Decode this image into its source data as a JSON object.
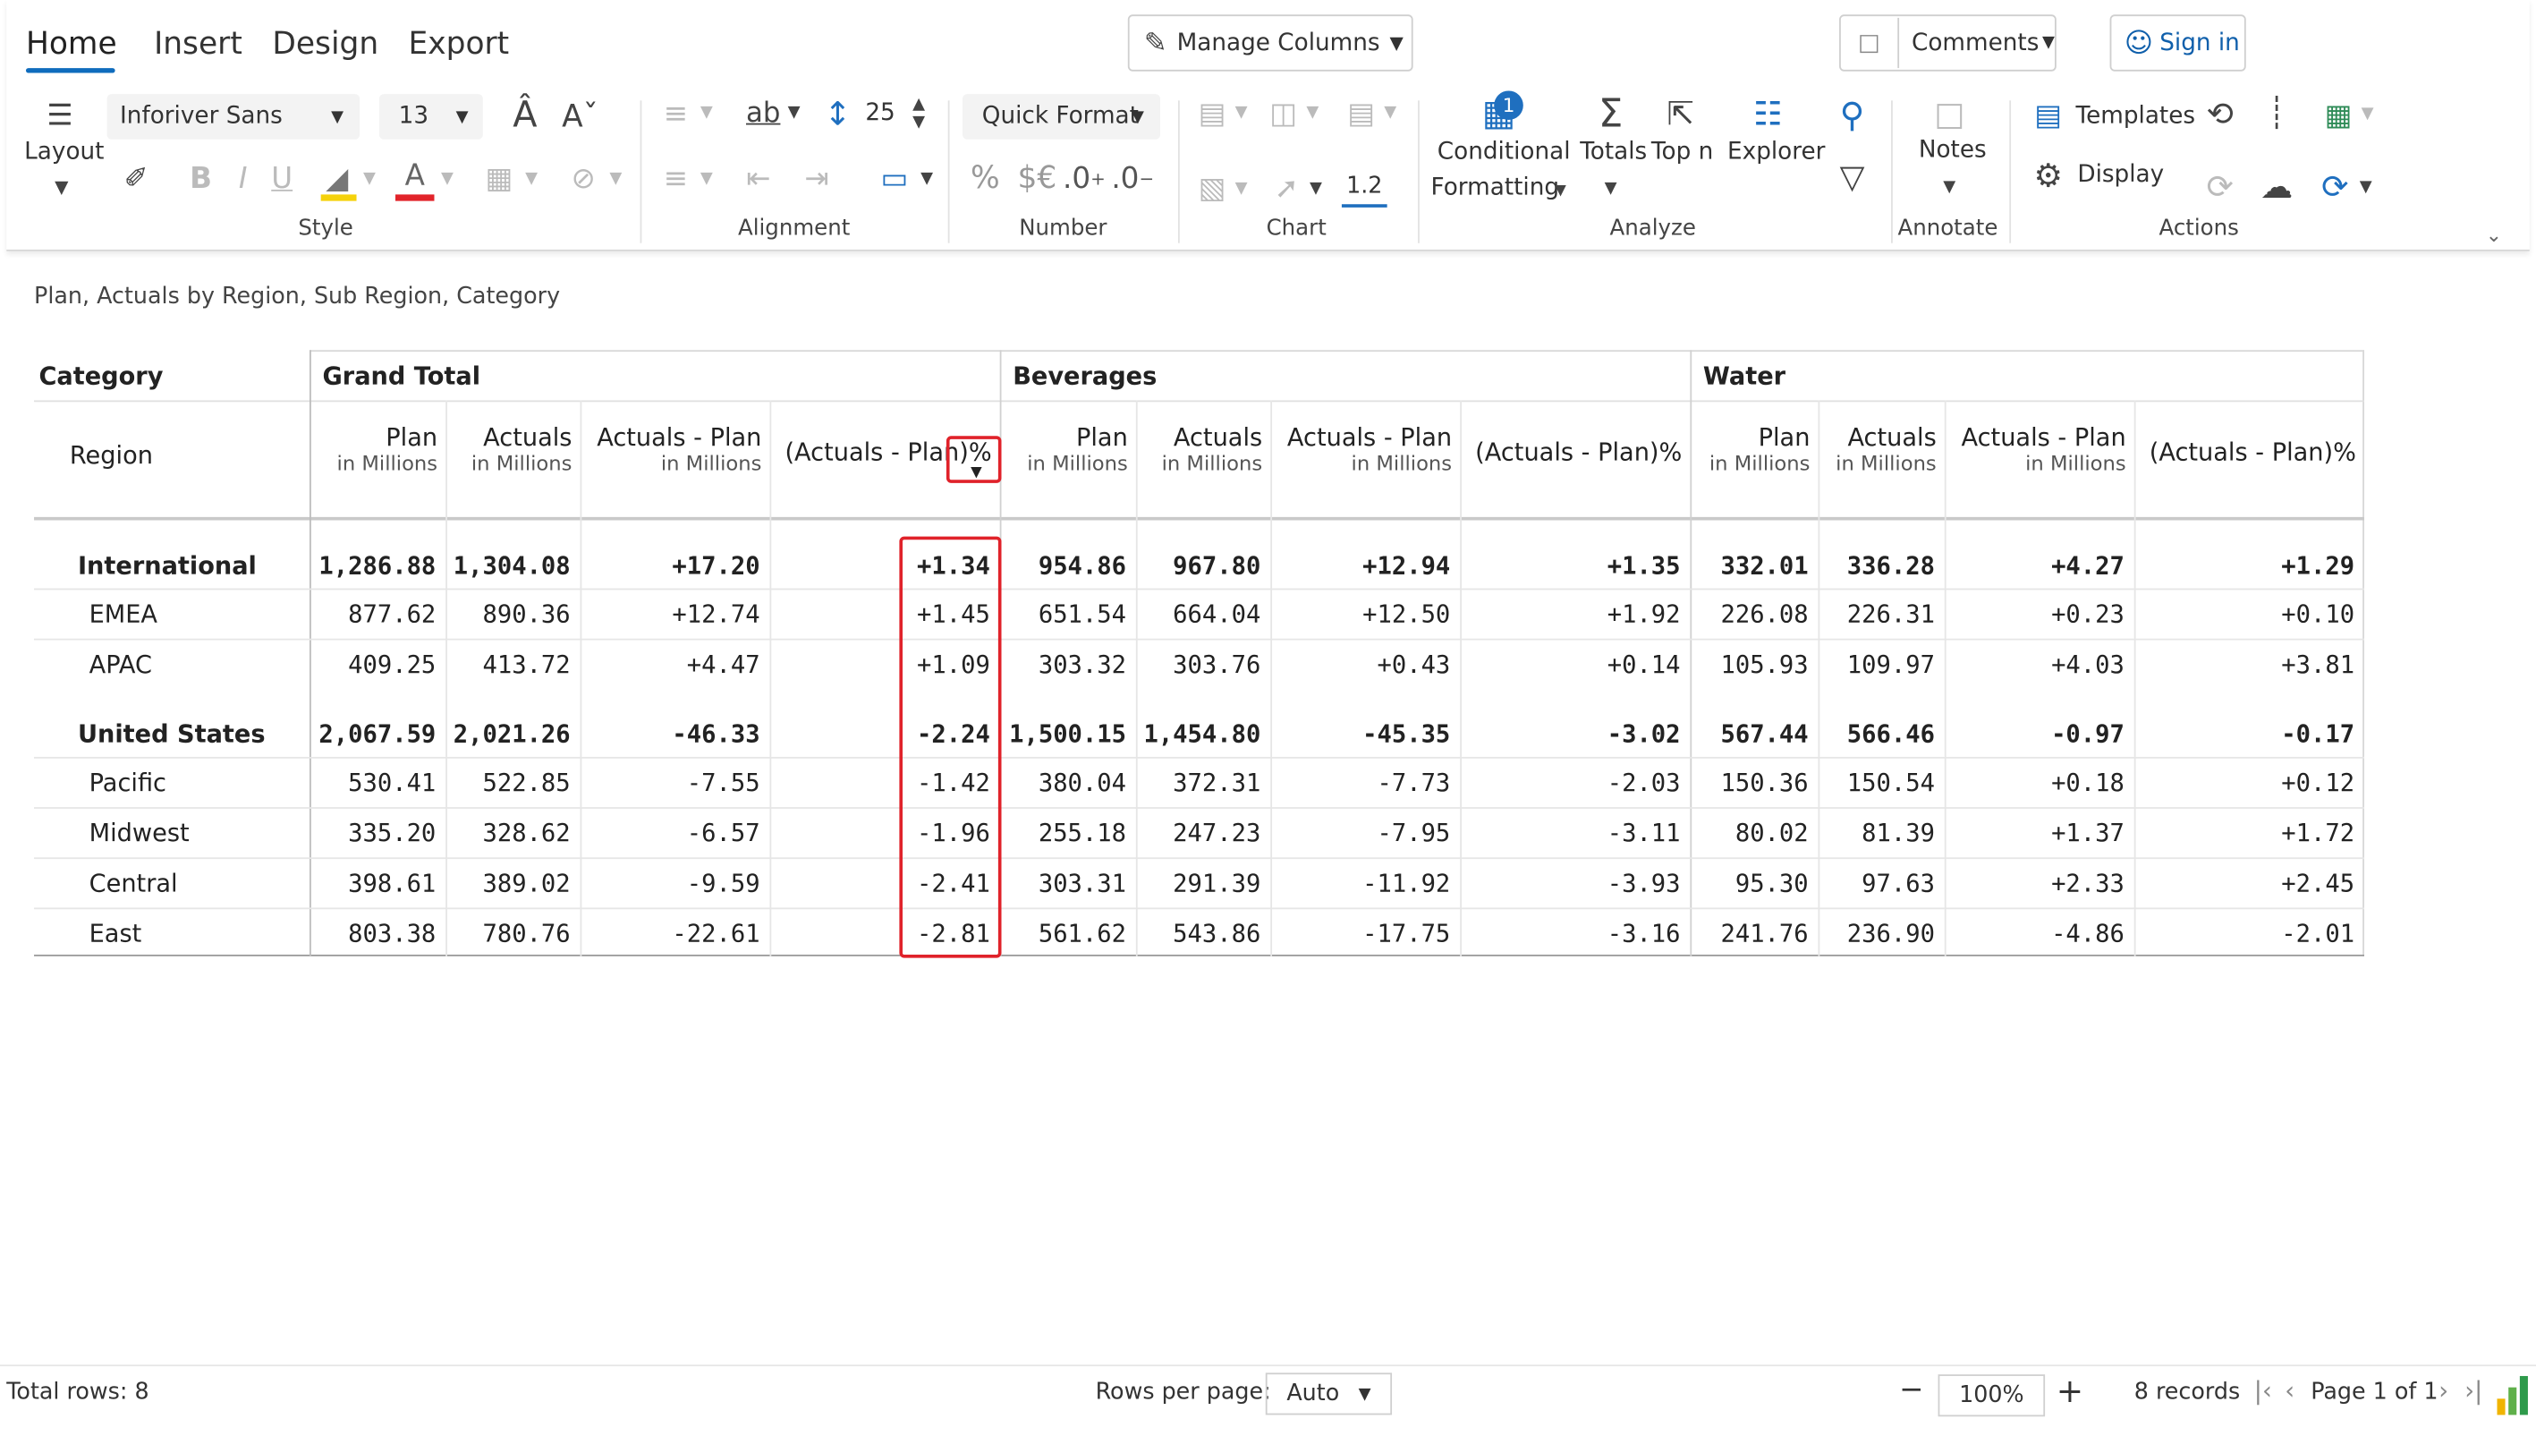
{
  "ribbon": {
    "tabs": [
      "Home",
      "Insert",
      "Design",
      "Export"
    ],
    "manage_columns": "Manage Columns",
    "comments": "Comments",
    "sign_in": "Sign in",
    "layout_label": "Layout",
    "font_name": "Inforiver Sans",
    "font_size": "13",
    "row_height": "25",
    "quick_format": "Quick Format",
    "number_percent": "%",
    "number_currency": "$€",
    "number_dec_inc": ".0",
    "number_dec_dec": ".0",
    "chart_value": "1.2",
    "conditional_formatting": [
      "Conditional",
      "Formatting"
    ],
    "cf_badge": "1",
    "totals": "Totals",
    "top_n": "Top n",
    "explorer": "Explorer",
    "notes": "Notes",
    "templates": "Templates",
    "display": "Display",
    "groups": {
      "style": "Style",
      "alignment": "Alignment",
      "number": "Number",
      "chart": "Chart",
      "analyze": "Analyze",
      "annotate": "Annotate",
      "actions": "Actions"
    },
    "colors": {
      "accent": "#0f6cbd",
      "highlight": "#e0222a"
    }
  },
  "report": {
    "subtitle": "Plan, Actuals by Region, Sub Region, Category",
    "category_header": "Category",
    "region_header": "Region",
    "groups": [
      "Grand Total",
      "Beverages",
      "Water"
    ],
    "measure_labels": [
      "Plan",
      "Actuals",
      "Actuals - Plan",
      "(Actuals - Plan)%"
    ],
    "unit_label": "in Millions",
    "rows": [
      {
        "label": "International",
        "level": 0,
        "values": [
          "1,286.88",
          "1,304.08",
          "+17.20",
          "+1.34",
          "954.86",
          "967.80",
          "+12.94",
          "+1.35",
          "332.01",
          "336.28",
          "+4.27",
          "+1.29"
        ]
      },
      {
        "label": "EMEA",
        "level": 1,
        "values": [
          "877.62",
          "890.36",
          "+12.74",
          "+1.45",
          "651.54",
          "664.04",
          "+12.50",
          "+1.92",
          "226.08",
          "226.31",
          "+0.23",
          "+0.10"
        ]
      },
      {
        "label": "APAC",
        "level": 1,
        "values": [
          "409.25",
          "413.72",
          "+4.47",
          "+1.09",
          "303.32",
          "303.76",
          "+0.43",
          "+0.14",
          "105.93",
          "109.97",
          "+4.03",
          "+3.81"
        ]
      },
      {
        "label": "United States",
        "level": 0,
        "values": [
          "2,067.59",
          "2,021.26",
          "-46.33",
          "-2.24",
          "1,500.15",
          "1,454.80",
          "-45.35",
          "-3.02",
          "567.44",
          "566.46",
          "-0.97",
          "-0.17"
        ]
      },
      {
        "label": "Pacific",
        "level": 1,
        "values": [
          "530.41",
          "522.85",
          "-7.55",
          "-1.42",
          "380.04",
          "372.31",
          "-7.73",
          "-2.03",
          "150.36",
          "150.54",
          "+0.18",
          "+0.12"
        ]
      },
      {
        "label": "Midwest",
        "level": 1,
        "values": [
          "335.20",
          "328.62",
          "-6.57",
          "-1.96",
          "255.18",
          "247.23",
          "-7.95",
          "-3.11",
          "80.02",
          "81.39",
          "+1.37",
          "+1.72"
        ]
      },
      {
        "label": "Central",
        "level": 1,
        "values": [
          "398.61",
          "389.02",
          "-9.59",
          "-2.41",
          "303.31",
          "291.39",
          "-11.92",
          "-3.93",
          "95.30",
          "97.63",
          "+2.33",
          "+2.45"
        ]
      },
      {
        "label": "East",
        "level": 1,
        "values": [
          "803.38",
          "780.76",
          "-22.61",
          "-2.81",
          "561.62",
          "543.86",
          "-17.75",
          "-3.16",
          "241.76",
          "236.90",
          "-4.86",
          "-2.01"
        ]
      }
    ]
  },
  "footer": {
    "total_rows": "Total rows: 8",
    "rows_per_page_label": "Rows per page:",
    "rows_per_page_value": "Auto",
    "zoom": "100%",
    "records": "8 records",
    "page_label": "Page 1 of 1"
  }
}
